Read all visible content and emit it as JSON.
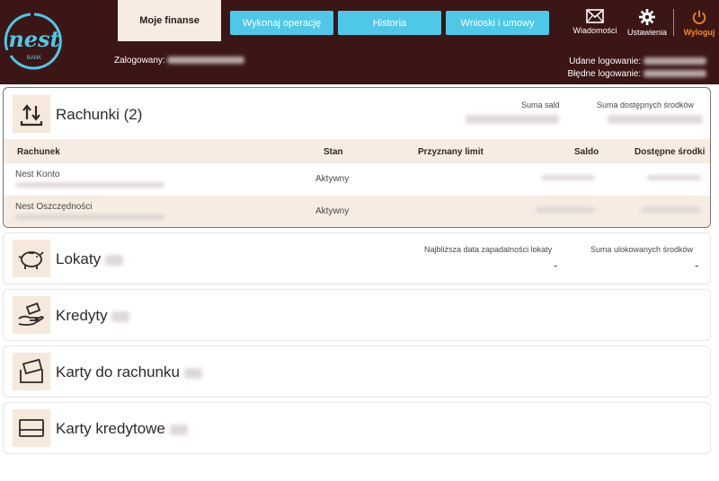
{
  "header": {
    "logo_text": "nest",
    "logo_sub": "BANK",
    "tabs": [
      {
        "label": "Moje finanse",
        "active": true
      },
      {
        "label": "Wykonaj operację"
      },
      {
        "label": "Historia"
      },
      {
        "label": "Wnioski i umowy"
      }
    ],
    "icons": {
      "messages": "Wiadomości",
      "settings": "Ustawienia",
      "logout": "Wyloguj"
    },
    "logged_label": "Zalogowany:",
    "last_success_label": "Udane logowanie:",
    "last_failed_label": "Błędne logowanie:"
  },
  "accounts": {
    "title": "Rachunki (2)",
    "sum_balance_label": "Suma sald",
    "sum_available_label": "Suma dostępnych środków",
    "columns": [
      "Rachunek",
      "Stan",
      "Przyznany limit",
      "Saldo",
      "Dostępne środki"
    ],
    "rows": [
      {
        "name": "Nest Konto",
        "status": "Aktywny"
      },
      {
        "name": "Nest Oszczędności",
        "status": "Aktywny"
      }
    ]
  },
  "deposits": {
    "title": "Lokaty",
    "nearest_label": "Najbliższa data zapadalności lokaty",
    "nearest_value": "-",
    "sum_label": "Suma ulokowanych środków",
    "sum_value": "-"
  },
  "credits": {
    "title": "Kredyty"
  },
  "debit_cards": {
    "title": "Karty do rachunku"
  },
  "credit_cards": {
    "title": "Karty kredytowe"
  },
  "colors": {
    "header_bg": "#3b1614",
    "tab_blue": "#4fc7e8",
    "accent_beige": "#f6ece2",
    "logout_orange": "#f08a2a"
  }
}
